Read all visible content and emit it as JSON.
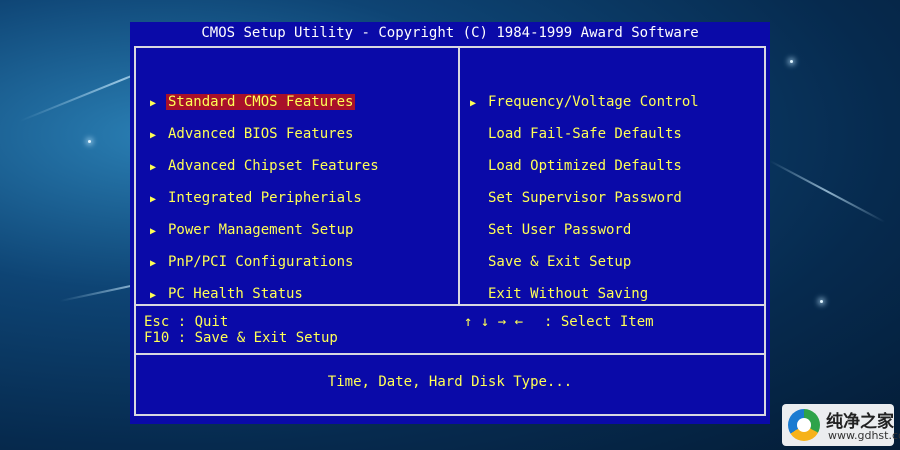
{
  "title": "CMOS Setup Utility - Copyright (C) 1984-1999 Award Software",
  "left_menu": [
    {
      "label": "Standard CMOS Features",
      "selected": true
    },
    {
      "label": "Advanced BIOS Features"
    },
    {
      "label": "Advanced Chipset Features"
    },
    {
      "label": "Integrated Peripherials"
    },
    {
      "label": "Power Management Setup"
    },
    {
      "label": "PnP/PCI Configurations"
    },
    {
      "label": "PC Health Status"
    }
  ],
  "right_menu": [
    {
      "label": "Frequency/Voltage Control",
      "arrow": true
    },
    {
      "label": "Load Fail-Safe Defaults"
    },
    {
      "label": "Load Optimized Defaults"
    },
    {
      "label": "Set Supervisor Password"
    },
    {
      "label": "Set User Password"
    },
    {
      "label": "Save & Exit Setup"
    },
    {
      "label": "Exit Without Saving"
    }
  ],
  "help": {
    "esc": "Esc : Quit",
    "f10": "F10 : Save & Exit Setup",
    "arrows": "↑ ↓ → ←",
    "arrows_desc": ": Select Item"
  },
  "status_text": "Time, Date, Hard Disk Type...",
  "logo": {
    "name": "纯净之家",
    "url": "www.gdhst.com"
  },
  "colors": {
    "bios_bg": "#0a0aa8",
    "text_yellow": "#ffff55",
    "highlight": "#a8102a",
    "border": "#d8d8e0"
  },
  "arrow_glyph": "▶"
}
